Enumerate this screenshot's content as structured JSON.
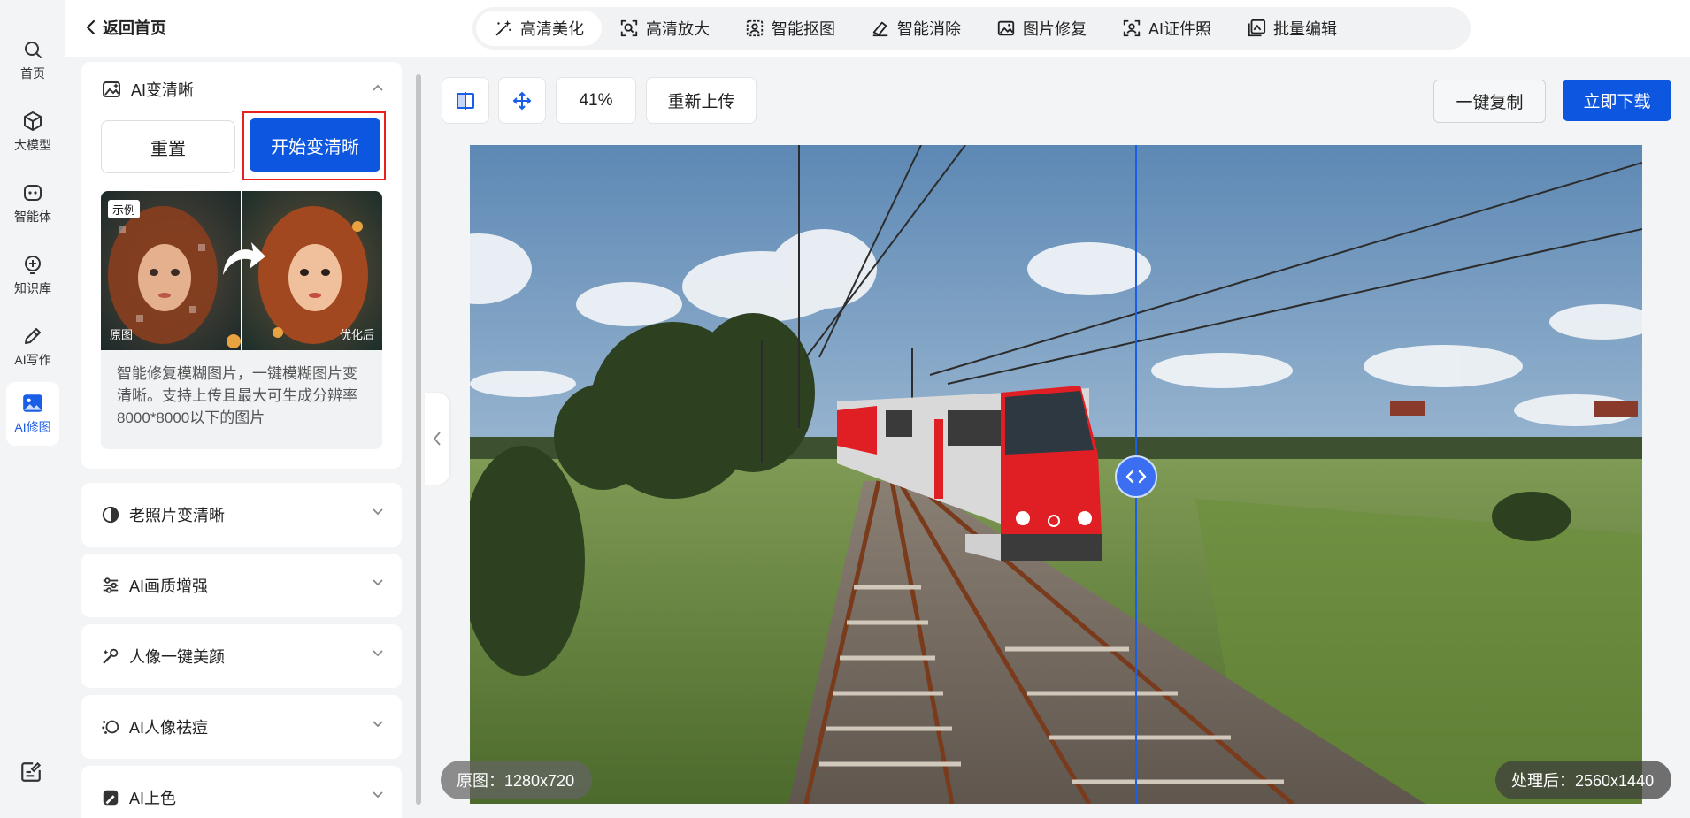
{
  "rail": {
    "items": [
      {
        "label": "首页",
        "icon": "search-icon"
      },
      {
        "label": "大模型",
        "icon": "cube-icon"
      },
      {
        "label": "智能体",
        "icon": "robot-icon"
      },
      {
        "label": "知识库",
        "icon": "knowledge-icon"
      },
      {
        "label": "AI写作",
        "icon": "pen-icon"
      },
      {
        "label": "AI修图",
        "icon": "image-icon"
      }
    ],
    "active_index": 5,
    "bottom_icon": "edit-note-icon"
  },
  "header": {
    "back_label": "返回首页",
    "tabs": [
      {
        "label": "高清美化",
        "icon": "magic-wand-icon"
      },
      {
        "label": "高清放大",
        "icon": "zoom-frame-icon"
      },
      {
        "label": "智能抠图",
        "icon": "cutout-icon"
      },
      {
        "label": "智能消除",
        "icon": "eraser-icon"
      },
      {
        "label": "图片修复",
        "icon": "image-repair-icon"
      },
      {
        "label": "AI证件照",
        "icon": "id-photo-icon"
      },
      {
        "label": "批量编辑",
        "icon": "batch-edit-icon"
      }
    ],
    "active_tab": 0
  },
  "panel": {
    "expanded": {
      "title": "AI变清晰",
      "reset_label": "重置",
      "start_label": "开始变清晰",
      "example_tag": "示例",
      "before_label": "原图",
      "after_label": "优化后",
      "description": "智能修复模糊图片，一键模糊图片变清晰。支持上传且最大可生成分辨率8000*8000以下的图片"
    },
    "sections": [
      {
        "title": "老照片变清晰",
        "icon": "old-photo-icon"
      },
      {
        "title": "AI画质增强",
        "icon": "sliders-icon"
      },
      {
        "title": "人像一键美颜",
        "icon": "beauty-icon"
      },
      {
        "title": "AI人像祛痘",
        "icon": "blemish-icon"
      },
      {
        "title": "AI上色",
        "icon": "colorize-icon"
      }
    ]
  },
  "canvas": {
    "zoom": "41%",
    "reupload_label": "重新上传",
    "copy_label": "一键复制",
    "download_label": "立即下载",
    "original_info": "原图：1280x720",
    "processed_info": "处理后：2560x1440"
  },
  "colors": {
    "accent": "#0d57e0",
    "highlight_frame": "#e8201e",
    "train_red": "#e01f25"
  }
}
